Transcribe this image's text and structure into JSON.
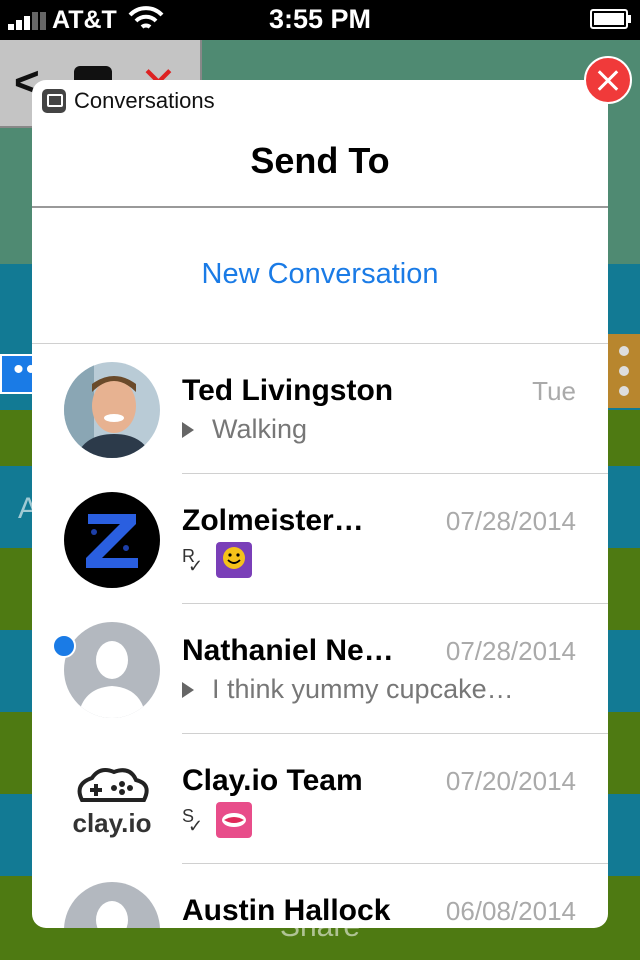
{
  "status_bar": {
    "carrier": "AT&T",
    "time": "3:55 PM"
  },
  "background_app": {
    "partial_text_left": "A",
    "share_label": "Share",
    "dots": "•••"
  },
  "modal": {
    "app_name": "Conversations",
    "title": "Send To",
    "new_conversation": "New Conversation"
  },
  "conversations": [
    {
      "name": "Ted Livingston",
      "date": "Tue",
      "message": "Walking"
    },
    {
      "name": "Zolmeister…",
      "date": "07/28/2014",
      "status": "R"
    },
    {
      "name": "Nathaniel Ne…",
      "date": "07/28/2014",
      "message": "I think yummy cupcake…"
    },
    {
      "name": "Clay.io Team",
      "date": "07/20/2014",
      "status": "S",
      "logo_text": "clay.io"
    },
    {
      "name": "Austin Hallock",
      "date": "06/08/2014"
    }
  ],
  "colors": {
    "accent": "#1a7be6",
    "close": "#f03a3a",
    "muted": "#aaaaaa"
  }
}
